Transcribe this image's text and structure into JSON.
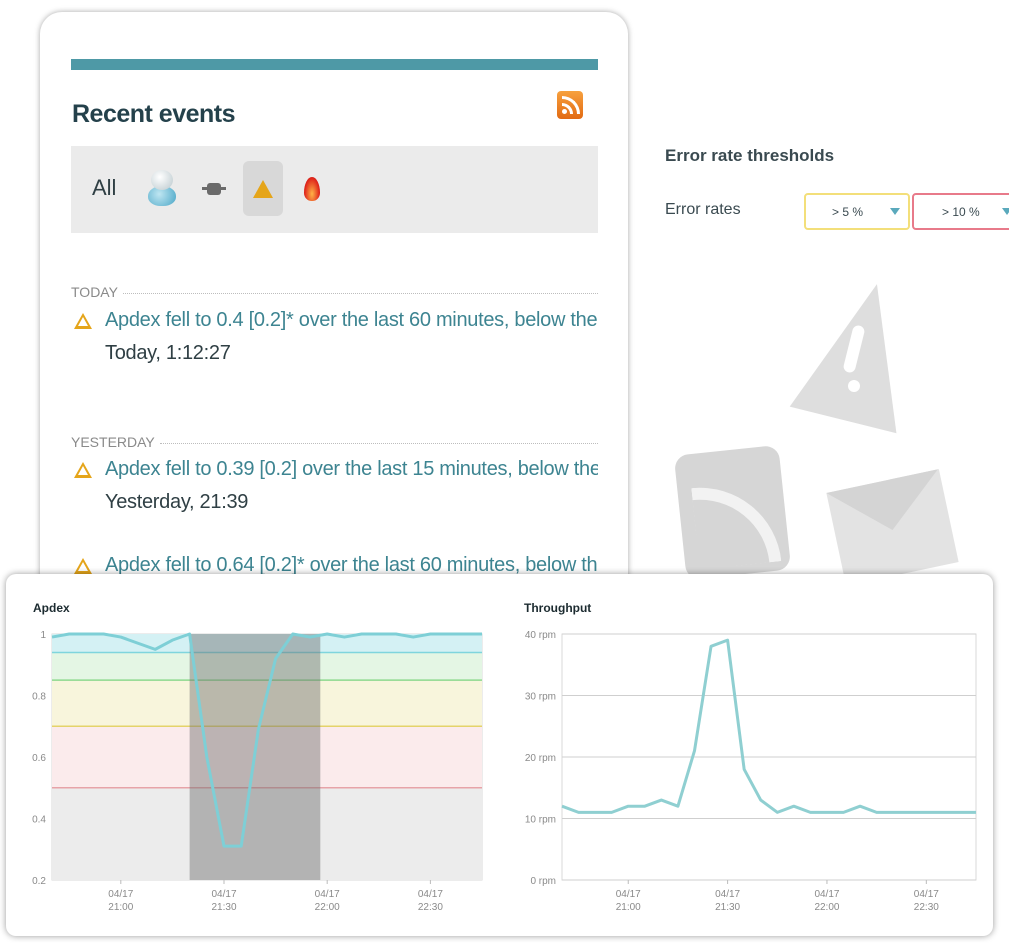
{
  "events": {
    "title": "Recent events",
    "filter_all_label": "All",
    "filters": [
      "user-icon",
      "plug-icon",
      "warning-icon",
      "fire-icon"
    ],
    "groups": [
      {
        "header": "TODAY",
        "items": [
          {
            "message": "Apdex fell to 0.4 [0.2]* over the last 60 minutes, below the",
            "time": "Today, 1:12:27"
          }
        ]
      },
      {
        "header": "YESTERDAY",
        "items": [
          {
            "message": "Apdex fell to 0.39 [0.2] over the last 15 minutes, below the",
            "time": "Yesterday, 21:39"
          },
          {
            "message": "Apdex fell to 0.64 [0.2]* over the last 60 minutes, below th",
            "time": ""
          }
        ]
      }
    ]
  },
  "thresholds": {
    "title": "Error rate thresholds",
    "error_rates_label": "Error rates",
    "warning_value": "> 5 %",
    "critical_value": "> 10 %",
    "warning_color": "#f3df7a",
    "critical_color": "#e87a8a"
  },
  "chart_data": [
    {
      "type": "line",
      "title": "Apdex",
      "ylim": [
        0.2,
        1.0
      ],
      "yticks": [
        "0.2",
        "0.4",
        "0.6",
        "0.8",
        "1"
      ],
      "xticks": [
        [
          "04/17",
          "21:00"
        ],
        [
          "04/17",
          "21:30"
        ],
        [
          "04/17",
          "22:00"
        ],
        [
          "04/17",
          "22:30"
        ]
      ],
      "zones": [
        {
          "from": 0.94,
          "to": 1.0,
          "color": "#d4f1f4"
        },
        {
          "from": 0.85,
          "to": 0.94,
          "color": "#e4f6e4"
        },
        {
          "from": 0.7,
          "to": 0.85,
          "color": "#f8f5dc"
        },
        {
          "from": 0.5,
          "to": 0.7,
          "color": "#fbebec"
        },
        {
          "from": 0.2,
          "to": 0.5,
          "color": "#ececec"
        }
      ],
      "highlight": {
        "from": "21:20",
        "to": "21:58"
      },
      "series": [
        {
          "x": [
            "20:40",
            "20:45",
            "20:50",
            "20:55",
            "21:00",
            "21:05",
            "21:10",
            "21:15",
            "21:20",
            "21:25",
            "21:30",
            "21:35",
            "21:40",
            "21:45",
            "21:50",
            "21:55",
            "22:00",
            "22:05",
            "22:10",
            "22:15",
            "22:20",
            "22:25",
            "22:30",
            "22:35",
            "22:40",
            "22:45"
          ],
          "values": [
            0.99,
            1.0,
            1.0,
            1.0,
            0.99,
            0.97,
            0.95,
            0.98,
            1.0,
            0.6,
            0.31,
            0.31,
            0.69,
            0.92,
            1.0,
            0.99,
            1.0,
            0.99,
            1.0,
            1.0,
            1.0,
            0.99,
            1.0,
            1.0,
            1.0,
            1.0
          ],
          "color": "#7ecfd6"
        }
      ],
      "grid": true
    },
    {
      "type": "line",
      "title": "Throughput",
      "ylim": [
        0,
        40
      ],
      "yticks": [
        "0 rpm",
        "10 rpm",
        "20 rpm",
        "30 rpm",
        "40 rpm"
      ],
      "xticks": [
        [
          "04/17",
          "21:00"
        ],
        [
          "04/17",
          "21:30"
        ],
        [
          "04/17",
          "22:00"
        ],
        [
          "04/17",
          "22:30"
        ]
      ],
      "series": [
        {
          "x": [
            "20:40",
            "20:45",
            "20:50",
            "20:55",
            "21:00",
            "21:05",
            "21:10",
            "21:15",
            "21:20",
            "21:25",
            "21:30",
            "21:35",
            "21:40",
            "21:45",
            "21:50",
            "21:55",
            "22:00",
            "22:05",
            "22:10",
            "22:15",
            "22:20",
            "22:25",
            "22:30",
            "22:35",
            "22:40",
            "22:45"
          ],
          "values": [
            12,
            11,
            11,
            11,
            12,
            12,
            13,
            12,
            21,
            38,
            39,
            18,
            13,
            11,
            12,
            11,
            11,
            11,
            12,
            11,
            11,
            11,
            11,
            11,
            11,
            11
          ],
          "color": "#8fcfd1"
        }
      ],
      "grid": true
    }
  ]
}
